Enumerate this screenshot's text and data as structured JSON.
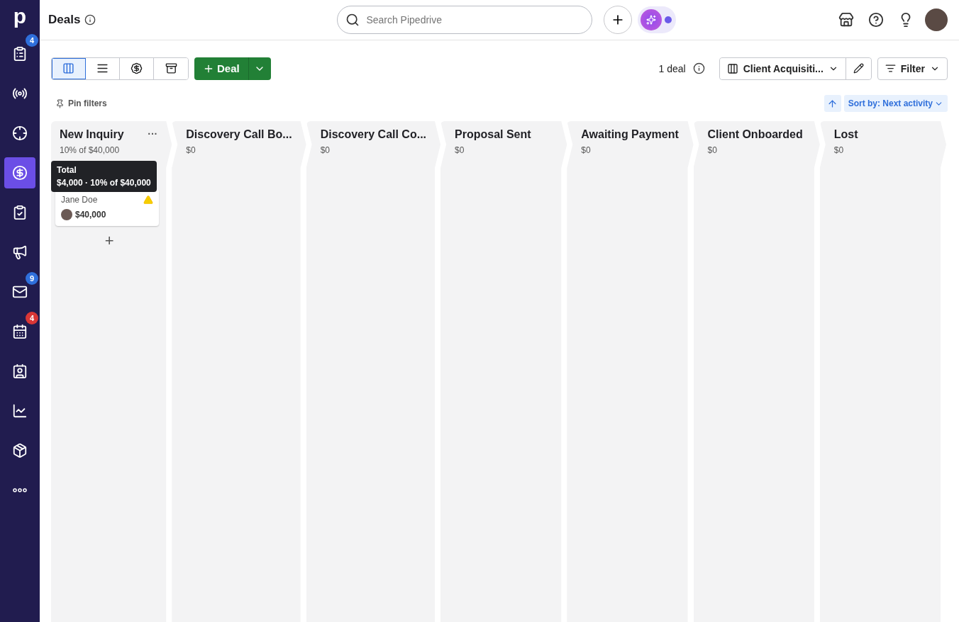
{
  "sidebar": {
    "logo": "p",
    "items": [
      {
        "selected": false,
        "badge": {
          "text": "4",
          "color": "#2f6fdb"
        }
      },
      {
        "selected": false
      },
      {
        "selected": false
      },
      {
        "selected": true
      },
      {
        "selected": false
      },
      {
        "selected": false
      },
      {
        "selected": false,
        "badge": {
          "text": "9",
          "color": "#2f6fdb"
        }
      },
      {
        "selected": false,
        "badge": {
          "text": "4",
          "color": "#d93636"
        }
      },
      {
        "selected": false
      },
      {
        "selected": false
      },
      {
        "selected": false
      },
      {
        "selected": false
      }
    ]
  },
  "header": {
    "title": "Deals",
    "search": {
      "placeholder": "Search Pipedrive"
    }
  },
  "toolbar": {
    "views": [
      {
        "selected": true
      },
      {
        "selected": false
      },
      {
        "selected": false
      },
      {
        "selected": false
      }
    ],
    "add_button": "Deal",
    "deal_count": "1 deal",
    "pipeline": "Client Acquisiti...",
    "filter": "Filter",
    "pin_filters": "Pin filters",
    "sort": "Sort by: Next activity"
  },
  "stages": [
    {
      "name": "New Inquiry",
      "summary": "10% of $40,000",
      "menu": "···",
      "tooltip": {
        "title": "Total",
        "text": "$4,000 · 10% of $40,000"
      },
      "deals": [
        {
          "person": "Jane Doe",
          "value": "$40,000",
          "warning": true
        }
      ],
      "add": "+"
    },
    {
      "name": "Discovery Call Bo...",
      "summary": "$0"
    },
    {
      "name": "Discovery Call Co...",
      "summary": "$0"
    },
    {
      "name": "Proposal Sent",
      "summary": "$0"
    },
    {
      "name": "Awaiting Payment",
      "summary": "$0"
    },
    {
      "name": "Client Onboarded",
      "summary": "$0"
    },
    {
      "name": "Lost",
      "summary": "$0"
    }
  ]
}
